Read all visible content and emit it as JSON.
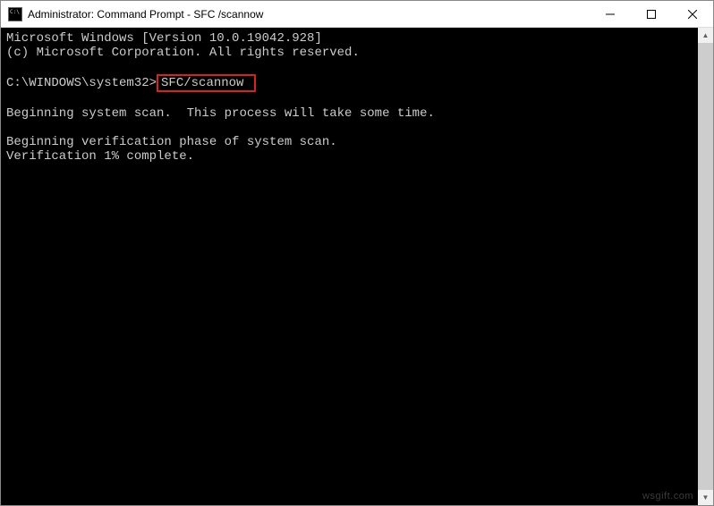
{
  "titlebar": {
    "text": "Administrator: Command Prompt - SFC /scannow"
  },
  "terminal": {
    "line1": "Microsoft Windows [Version 10.0.19042.928]",
    "line2": "(c) Microsoft Corporation. All rights reserved.",
    "blank1": "",
    "prompt_prefix": "C:\\WINDOWS\\system32>",
    "prompt_command": "SFC/scannow",
    "blank2": "",
    "line3": "Beginning system scan.  This process will take some time.",
    "blank3": "",
    "line4": "Beginning verification phase of system scan.",
    "line5": "Verification 1% complete."
  },
  "watermark": "wsgift.com"
}
